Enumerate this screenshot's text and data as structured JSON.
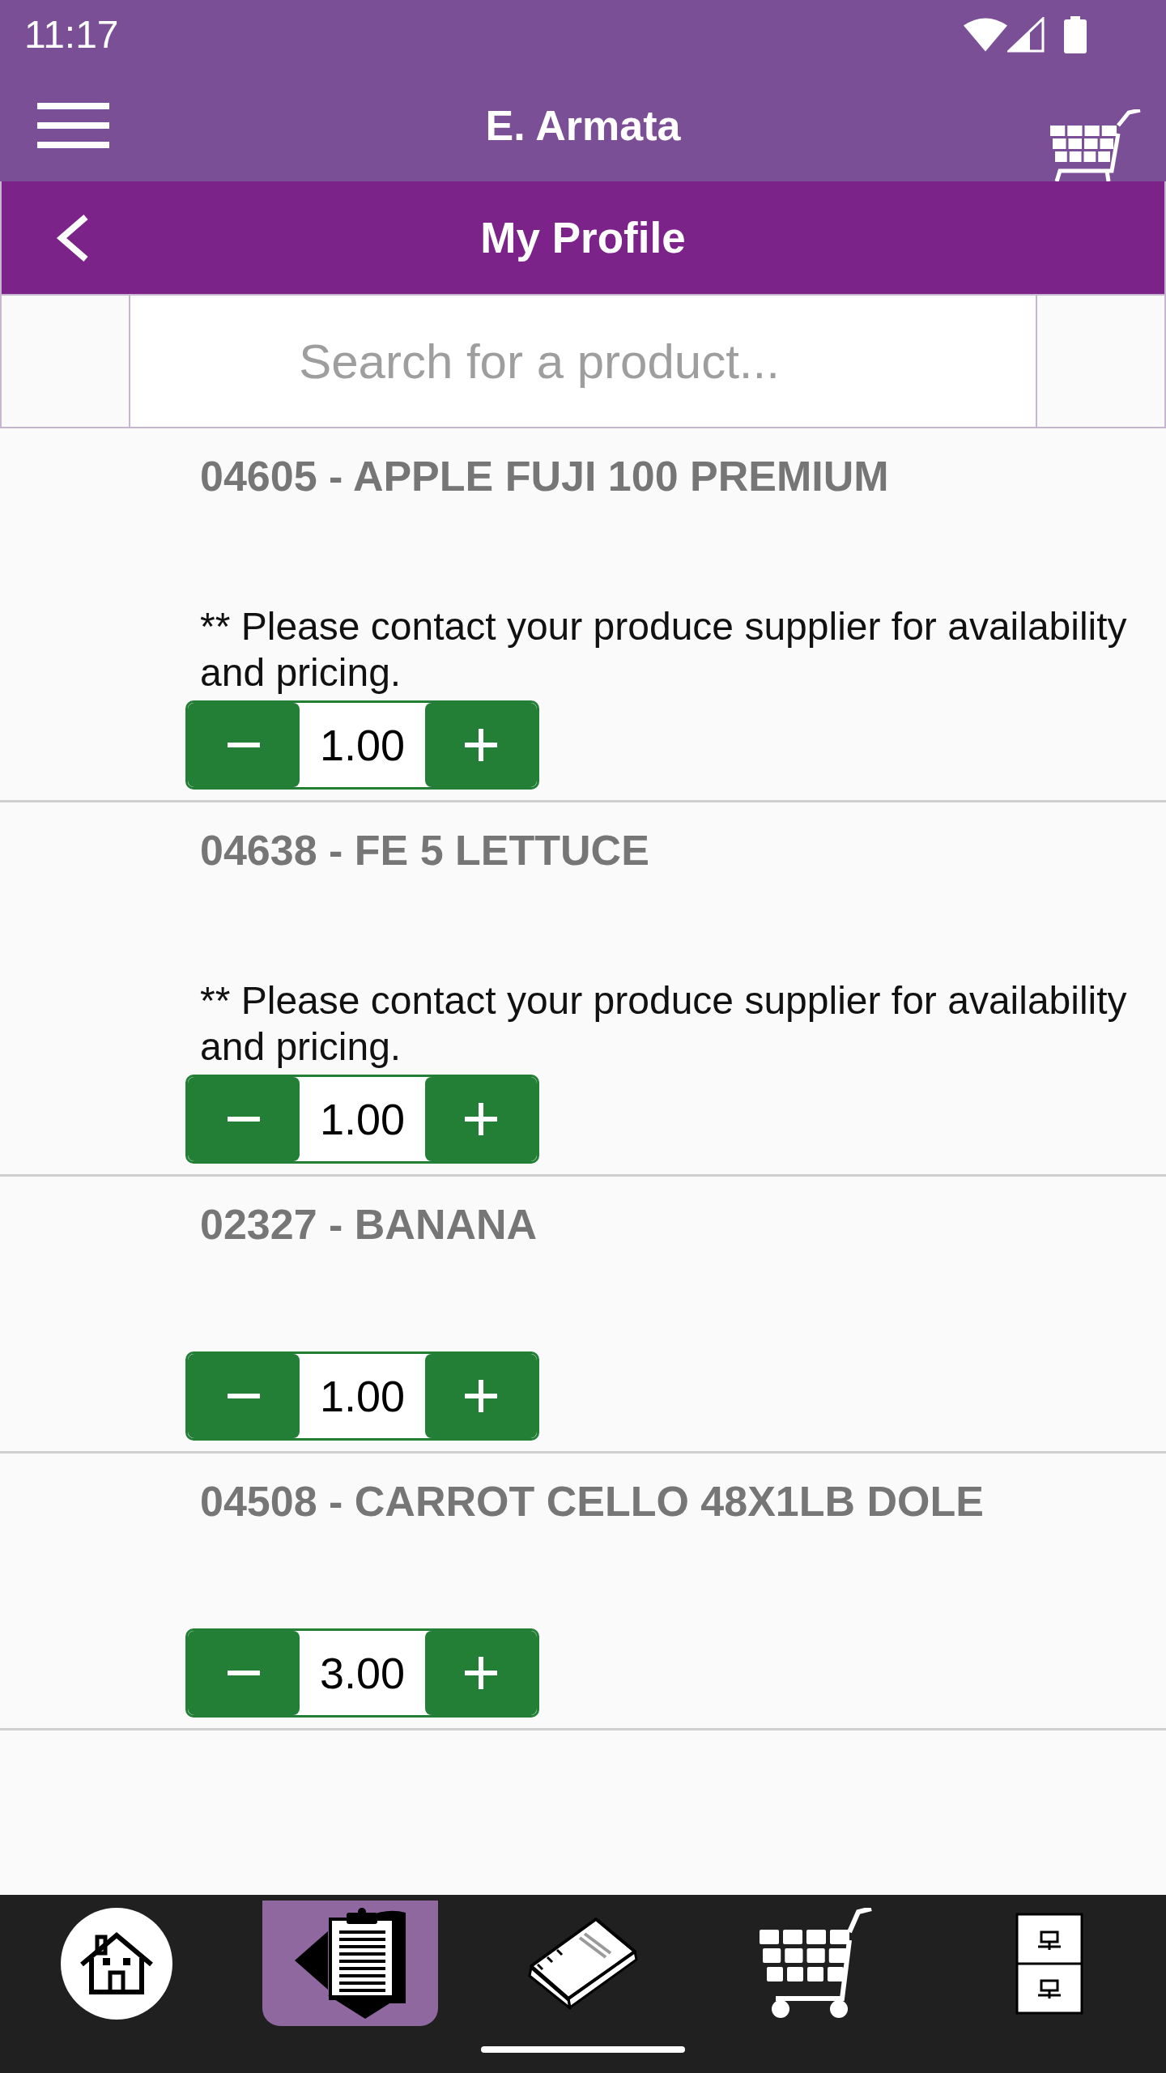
{
  "status_bar": {
    "time": "11:17"
  },
  "header": {
    "title": "E. Armata"
  },
  "page_bar": {
    "title": "My Profile"
  },
  "search": {
    "placeholder": "Search for a product..."
  },
  "products": [
    {
      "title": "04605 - APPLE FUJI 100 PREMIUM",
      "note": "** Please contact your produce supplier for availability and pricing.",
      "quantity": "1.00"
    },
    {
      "title": "04638 - FE 5 LETTUCE",
      "note": "** Please contact your produce supplier for availability and pricing.",
      "quantity": "1.00"
    },
    {
      "title": "02327 - BANANA",
      "quantity": "1.00"
    },
    {
      "title": "04508 - CARROT CELLO 48X1LB DOLE",
      "quantity": "3.00"
    }
  ],
  "bottom_nav": [
    {
      "selected": false
    },
    {
      "selected": true
    },
    {
      "selected": false
    },
    {
      "selected": false
    },
    {
      "selected": false
    }
  ]
}
